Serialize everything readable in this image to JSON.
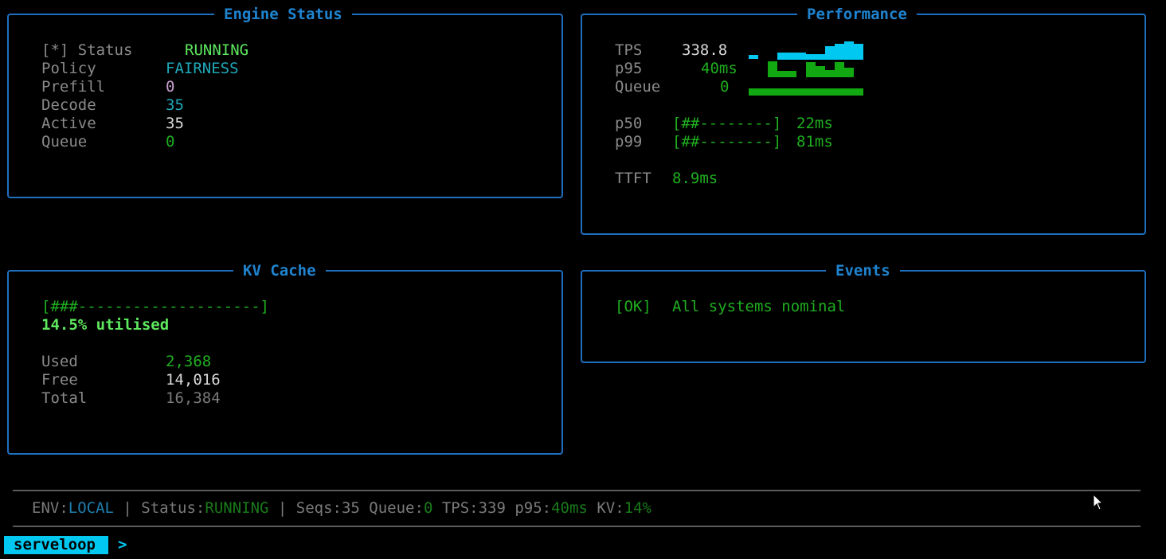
{
  "engine": {
    "title": "Engine Status",
    "rows": [
      {
        "label": "[*] Status",
        "value": "RUNNING"
      },
      {
        "label": "Policy",
        "value": "FAIRNESS"
      },
      {
        "label": "Prefill",
        "value": "0"
      },
      {
        "label": "Decode",
        "value": "35"
      },
      {
        "label": "Active",
        "value": "35"
      },
      {
        "label": "Queue",
        "value": "0"
      }
    ]
  },
  "performance": {
    "title": "Performance",
    "tps_label": "TPS",
    "tps_value": "338.8",
    "p95_label": "p95",
    "p95_value": "40ms",
    "queue_label": "Queue",
    "queue_value": "0",
    "p50_label": "p50",
    "p50_bar": "[##--------]",
    "p50_value": "22ms",
    "p99_label": "p99",
    "p99_bar": "[##--------]",
    "p99_value": "81ms",
    "ttft_label": "TTFT",
    "ttft_value": "8.9ms",
    "colors": {
      "tps_spark": "#00c8f0",
      "latency_spark": "#11a811"
    }
  },
  "kv": {
    "title": "KV Cache",
    "bar": "[###--------------------]",
    "util": "14.5% utilised",
    "used_label": "Used",
    "used_value": "2,368",
    "free_label": "Free",
    "free_value": "14,016",
    "total_label": "Total",
    "total_value": "16,384"
  },
  "events": {
    "title": "Events",
    "tag": "[OK]",
    "message": "All systems nominal"
  },
  "statusbar": {
    "env_label": "ENV:",
    "env_value": "LOCAL",
    "sep1": " | ",
    "status_label": "Status:",
    "status_value": "RUNNING",
    "sep2": " | ",
    "seqs": "Seqs:35 ",
    "queue_label": "Queue:",
    "queue_value": "0",
    "tps": " TPS:339 ",
    "p95_label": "p95:",
    "p95_value": "40ms",
    "kv_label": " KV:",
    "kv_value": "14%"
  },
  "prompt": {
    "tag": "serveloop",
    "arrow": ">"
  }
}
